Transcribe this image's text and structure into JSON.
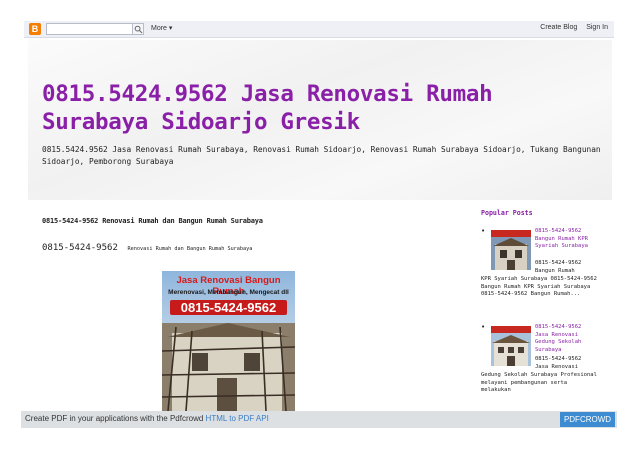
{
  "navbar": {
    "logo_letter": "B",
    "search_value": "",
    "more_label": "More",
    "create_blog_label": "Create Blog",
    "sign_in_label": "Sign In"
  },
  "header": {
    "title": "0815.5424.9562 Jasa Renovasi Rumah Surabaya Sidoarjo Gresik",
    "description": "0815.5424.9562 Jasa Renovasi Rumah Surabaya, Renovasi Rumah Sidoarjo, Renovasi Rumah Surabaya Sidoarjo, Tukang Bangunan Sidoarjo, Pemborong Surabaya"
  },
  "post": {
    "title": "0815-5424-9562 Renovasi Rumah dan Bangun Rumah Surabaya",
    "sub_big": "0815-5424-9562",
    "sub_small": "Renovasi Rumah dan Bangun Rumah Surabaya",
    "image": {
      "line1": "Jasa Renovasi Bangun Rumah",
      "line2": "Merenovasi, Membangun, Mengecat dll",
      "line3": "0815-5424-9562"
    }
  },
  "sidebar": {
    "title": "Popular Posts",
    "items": [
      {
        "link": "0815-5424-9562 Bangun Rumah KPR Syariah Surabaya",
        "snippet_top": "0815-5424-9562 Bangun Rumah",
        "snippet_bottom": "KPR Syariah Surabaya 0815-5424-9562 Bangun Rumah KPR Syariah Surabaya 0815-5424-9562 Bangun Rumah..."
      },
      {
        "link": "0815-5424-9562 Jasa Renovasi Gedung Sekolah Surabaya",
        "snippet_top": "0815-5424-9562 Jasa Renovasi",
        "snippet_bottom": "Gedung Sekolah Surabaya Profesional melayani pembangunan serta melakukan"
      }
    ]
  },
  "pdfbar": {
    "text_prefix": "Create PDF in your applications with the Pdfcrowd",
    "link": "HTML to PDF API",
    "button": "PDFCROWD"
  },
  "colors": {
    "title_purple": "#8a1fa8",
    "pdf_blue": "#3d8bd0",
    "blogger_orange": "#f57d00"
  }
}
